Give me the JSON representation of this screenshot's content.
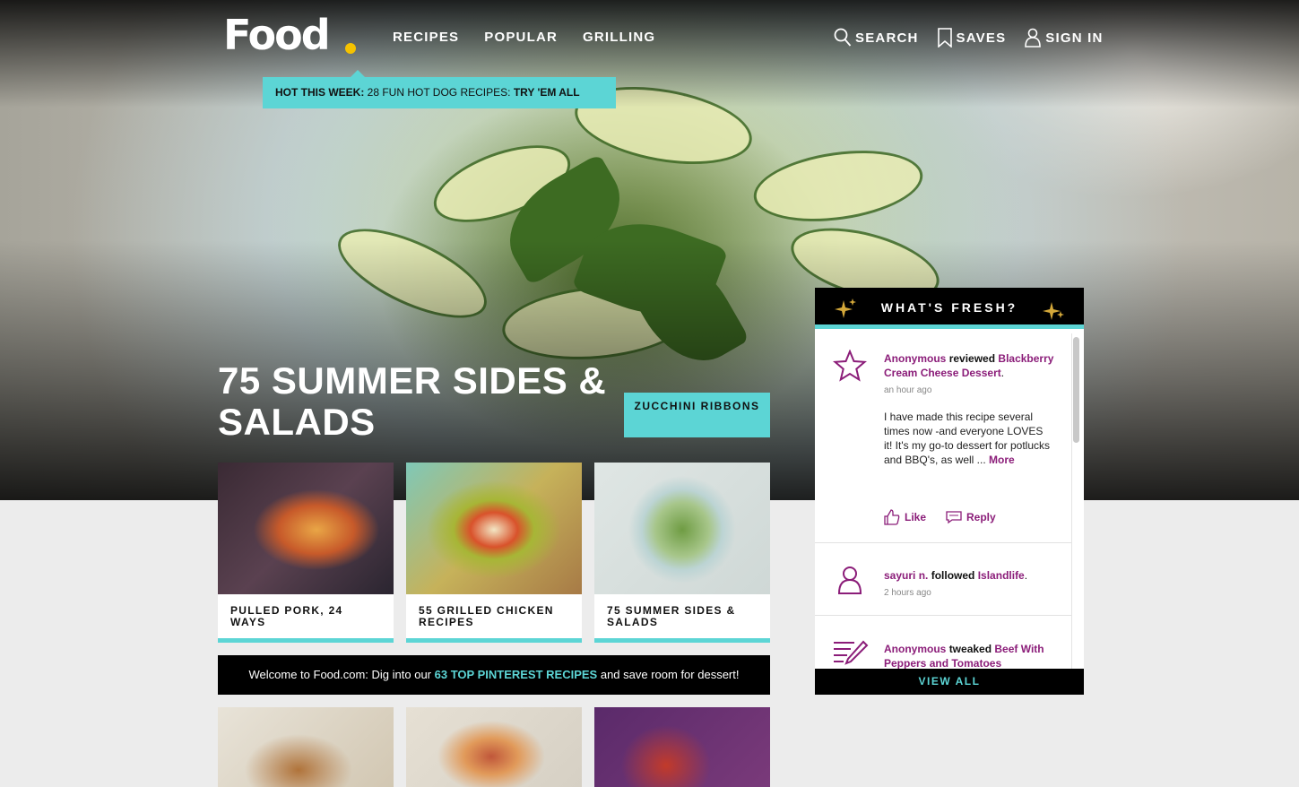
{
  "header": {
    "logo": "Food",
    "nav": [
      "RECIPES",
      "POPULAR",
      "GRILLING"
    ],
    "search": "SEARCH",
    "saves": "SAVES",
    "signin": "SIGN IN"
  },
  "hot": {
    "label": "HOT THIS WEEK:",
    "text": "28 FUN HOT DOG RECIPES:",
    "cta": "TRY 'EM ALL"
  },
  "hero": {
    "title": "75 SUMMER SIDES & SALADS",
    "button": "ZUCCHINI RIBBONS"
  },
  "cards": [
    {
      "caption": "PULLED PORK, 24 WAYS"
    },
    {
      "caption": "55 GRILLED CHICKEN RECIPES"
    },
    {
      "caption": "75 SUMMER SIDES & SALADS"
    }
  ],
  "welcome": {
    "before": "Welcome to Food.com: Dig into our",
    "link": "63 TOP PINTEREST RECIPES",
    "after": "and save room for dessert!"
  },
  "fresh": {
    "title": "WHAT'S FRESH?",
    "entries": [
      {
        "user": "Anonymous",
        "action": "reviewed",
        "target": "Blackberry Cream Cheese Dessert",
        "time": "an hour ago",
        "review": "I have made this recipe several times now -and everyone LOVES it! It's my go-to dessert for potlucks and BBQ's, as well ...",
        "more": "More",
        "like": "Like",
        "reply": "Reply"
      },
      {
        "user": "sayuri n.",
        "action": "followed",
        "target": "Islandlife",
        "time": "2 hours ago"
      },
      {
        "user": "Anonymous",
        "action": "tweaked",
        "target": "Beef With Peppers and Tomatoes"
      }
    ],
    "view_all": "VIEW ALL"
  },
  "colors": {
    "accent": "#5cd5d5",
    "purple": "#8b1d79",
    "logo_dot": "#f5c200"
  }
}
